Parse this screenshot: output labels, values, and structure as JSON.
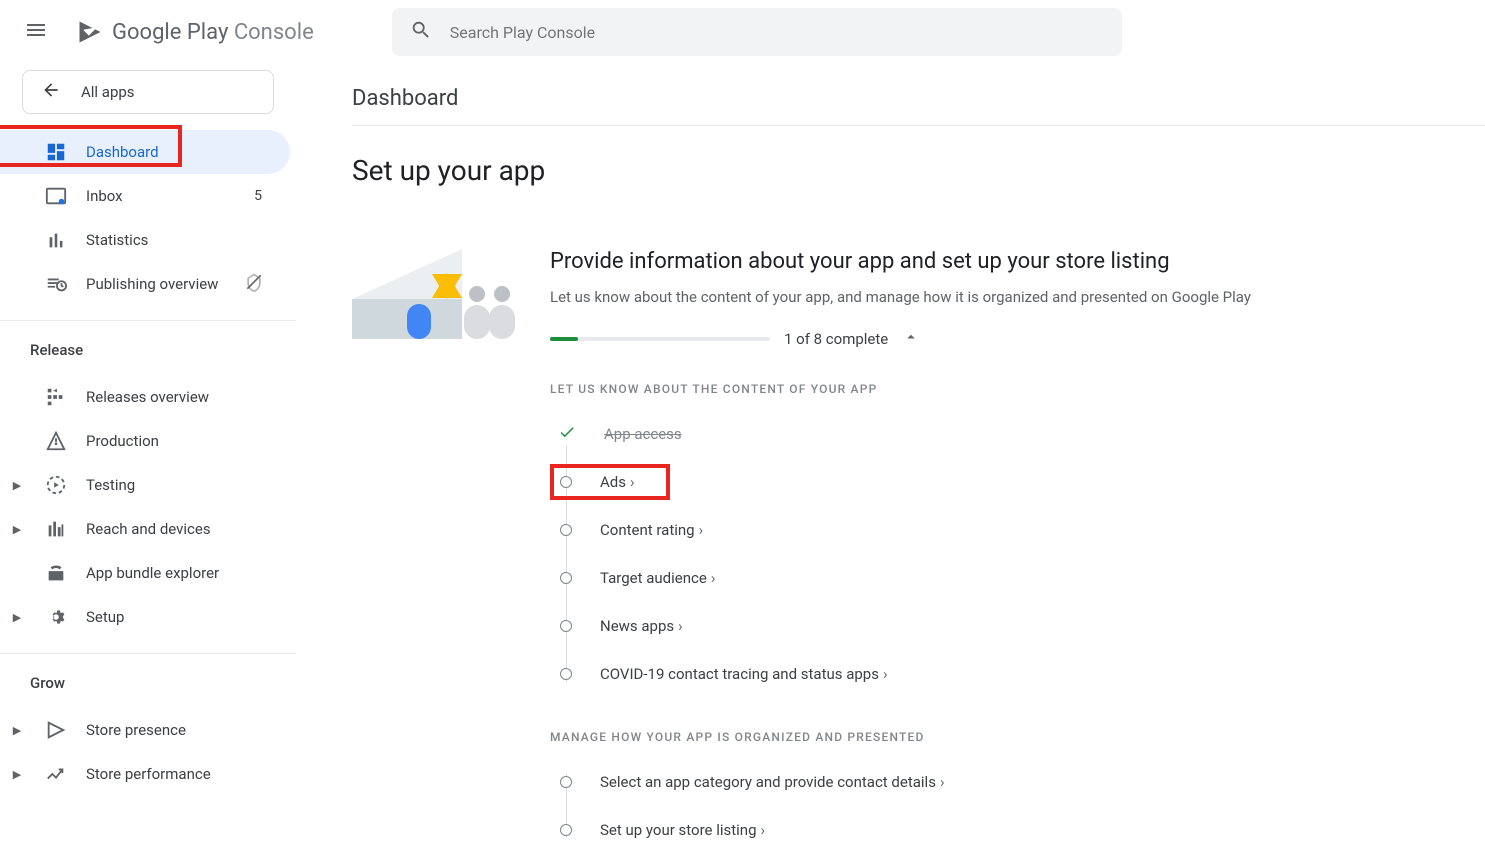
{
  "brand": {
    "name1": "Google Play",
    "name2": " Console"
  },
  "search": {
    "placeholder": "Search Play Console"
  },
  "allApps": "All apps",
  "nav": {
    "dashboard": "Dashboard",
    "inbox": "Inbox",
    "inboxCount": "5",
    "statistics": "Statistics",
    "publishing": "Publishing overview",
    "sectionRelease": "Release",
    "releasesOverview": "Releases overview",
    "production": "Production",
    "testing": "Testing",
    "reach": "Reach and devices",
    "bundle": "App bundle explorer",
    "setup": "Setup",
    "sectionGrow": "Grow",
    "storePresence": "Store presence",
    "storePerformance": "Store performance"
  },
  "page": {
    "header": "Dashboard",
    "title": "Set up your app"
  },
  "setup": {
    "heading": "Provide information about your app and set up your store listing",
    "sub": "Let us know about the content of your app, and manage how it is organized and presented on Google Play",
    "progressText": "1 of 8 complete",
    "progressPercent": 12.5
  },
  "tasks": {
    "section1": "LET US KNOW ABOUT THE CONTENT OF YOUR APP",
    "section2": "MANAGE HOW YOUR APP IS ORGANIZED AND PRESENTED",
    "appAccess": "App access",
    "ads": "Ads",
    "contentRating": "Content rating",
    "targetAudience": "Target audience",
    "newsApps": "News apps",
    "covid": "COVID-19 contact tracing and status apps",
    "category": "Select an app category and provide contact details",
    "storeListing": "Set up your store listing"
  }
}
